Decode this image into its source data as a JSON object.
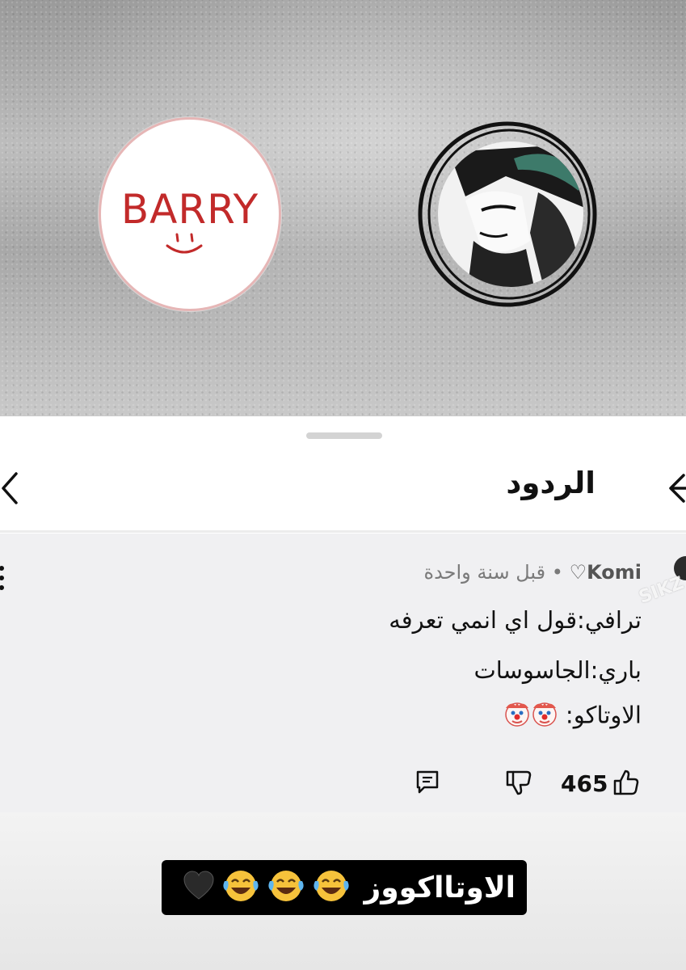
{
  "hero": {
    "left_avatar_text": "BARRY",
    "left_avatar_icon": "smiley-face",
    "right_avatar_icon": "anime-character-portrait"
  },
  "sheet": {
    "title": "الردود",
    "back_icon": "chevron-left",
    "forward_icon": "arrow-left"
  },
  "comment": {
    "author": "Komi♡",
    "separator": "•",
    "time": "قبل سنة واحدة",
    "lines": [
      "ترافي:قول اي انمي تعرفه",
      "باري:الجاسوسات",
      "الاوتاكو:"
    ],
    "line3_emojis": "clown-face-x2",
    "like_count": "465",
    "watermark": "SIKZ"
  },
  "caption": {
    "text": "الاوتااكووز",
    "emojis": [
      "crying-laughing-face",
      "crying-laughing-face",
      "crying-laughing-face",
      "black-heart"
    ]
  },
  "colors": {
    "accent_red": "#c22a2a",
    "sheet_bg": "#ffffff",
    "card_bg": "#f0f0f2",
    "caption_bg": "#000000"
  }
}
